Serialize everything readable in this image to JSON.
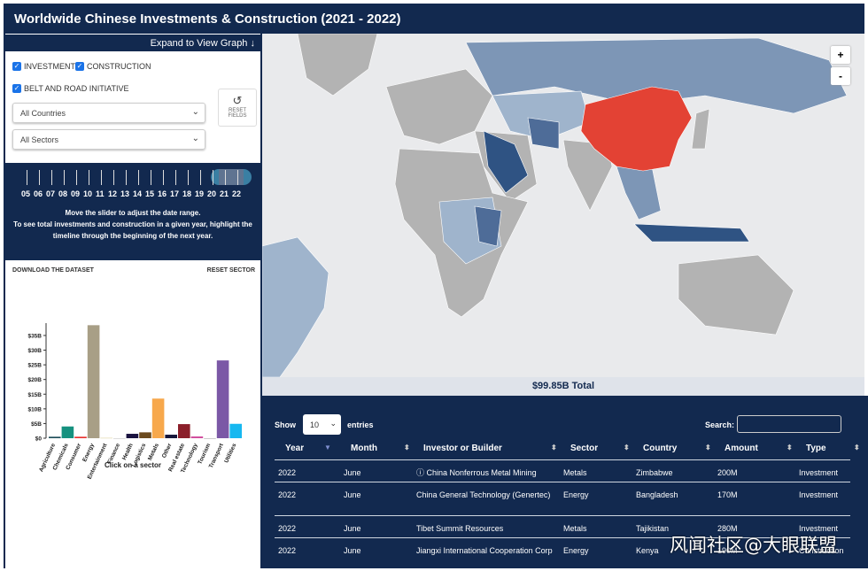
{
  "title": "Worldwide Chinese Investments & Construction (2021 - 2022)",
  "expand_label": "Expand to View Graph",
  "filters": {
    "investment": "INVESTMENT",
    "construction": "CONSTRUCTION",
    "bri": "BELT AND ROAD INITIATIVE",
    "countries": "All Countries",
    "sectors": "All Sectors",
    "reset_line1": "RESET",
    "reset_line2": "FIELDS"
  },
  "slider": {
    "years": [
      "05",
      "06",
      "07",
      "08",
      "09",
      "10",
      "11",
      "12",
      "13",
      "14",
      "15",
      "16",
      "17",
      "18",
      "19",
      "20",
      "21",
      "22"
    ],
    "note1": "Move the slider to adjust the date range.",
    "note2": "To see total investments and construction in a given year, highlight the",
    "note3": "timeline through the beginning of the next year."
  },
  "download_label": "DOWNLOAD THE DATASET",
  "reset_sector_label": "RESET SECTOR",
  "chart_caption": "Click on a sector",
  "chart_data": {
    "type": "bar",
    "title": "",
    "xlabel": "",
    "ylabel": "",
    "ylim": [
      0,
      38
    ],
    "yticks": [
      "$0",
      "$5B",
      "$10B",
      "$15B",
      "$20B",
      "$25B",
      "$30B",
      "$35B"
    ],
    "categories": [
      "Agriculture",
      "Chemicals",
      "Consumer",
      "Energy",
      "Entertainment",
      "Finance",
      "Health",
      "Logistics",
      "Metals",
      "Other",
      "Real estate",
      "Technology",
      "Tourism",
      "Transport",
      "Utilities"
    ],
    "values": [
      0.5,
      4,
      0.5,
      38.5,
      0.1,
      0,
      1.5,
      2,
      13.5,
      1.2,
      4.8,
      0.6,
      0,
      26.5,
      4.9
    ],
    "colors": [
      "#1f4e5a",
      "#16917f",
      "#e8322f",
      "#a89f86",
      "#d9c98c",
      "#bbbbbb",
      "#1a1340",
      "#6b4a1e",
      "#f7a84c",
      "#15153a",
      "#8b1f2a",
      "#d24f9e",
      "#999999",
      "#7b58a6",
      "#17b8f0"
    ]
  },
  "map": {
    "zoom_in": "+",
    "zoom_out": "-",
    "highlight": "#e34234"
  },
  "total": "$99.85B Total",
  "table": {
    "show": "Show",
    "entries": "entries",
    "page_size": "10",
    "search": "Search:",
    "headers": [
      "Year",
      "Month",
      "Investor or Builder",
      "Sector",
      "Country",
      "Amount",
      "Type"
    ],
    "rows": [
      [
        "2022",
        "June",
        "China Nonferrous Metal Mining",
        "Metals",
        "Zimbabwe",
        "200M",
        "Investment"
      ],
      [
        "2022",
        "June",
        "China General Technology (Genertec)",
        "Energy",
        "Bangladesh",
        "170M",
        "Investment"
      ],
      [
        "2022",
        "June",
        "Tibet Summit Resources",
        "Metals",
        "Tajikistan",
        "280M",
        "Investment"
      ],
      [
        "2022",
        "June",
        "Jiangxi International Cooperation Corp",
        "Energy",
        "Kenya",
        "190M",
        "Construction"
      ]
    ]
  },
  "watermark": "风闻社区@大眼联盟"
}
